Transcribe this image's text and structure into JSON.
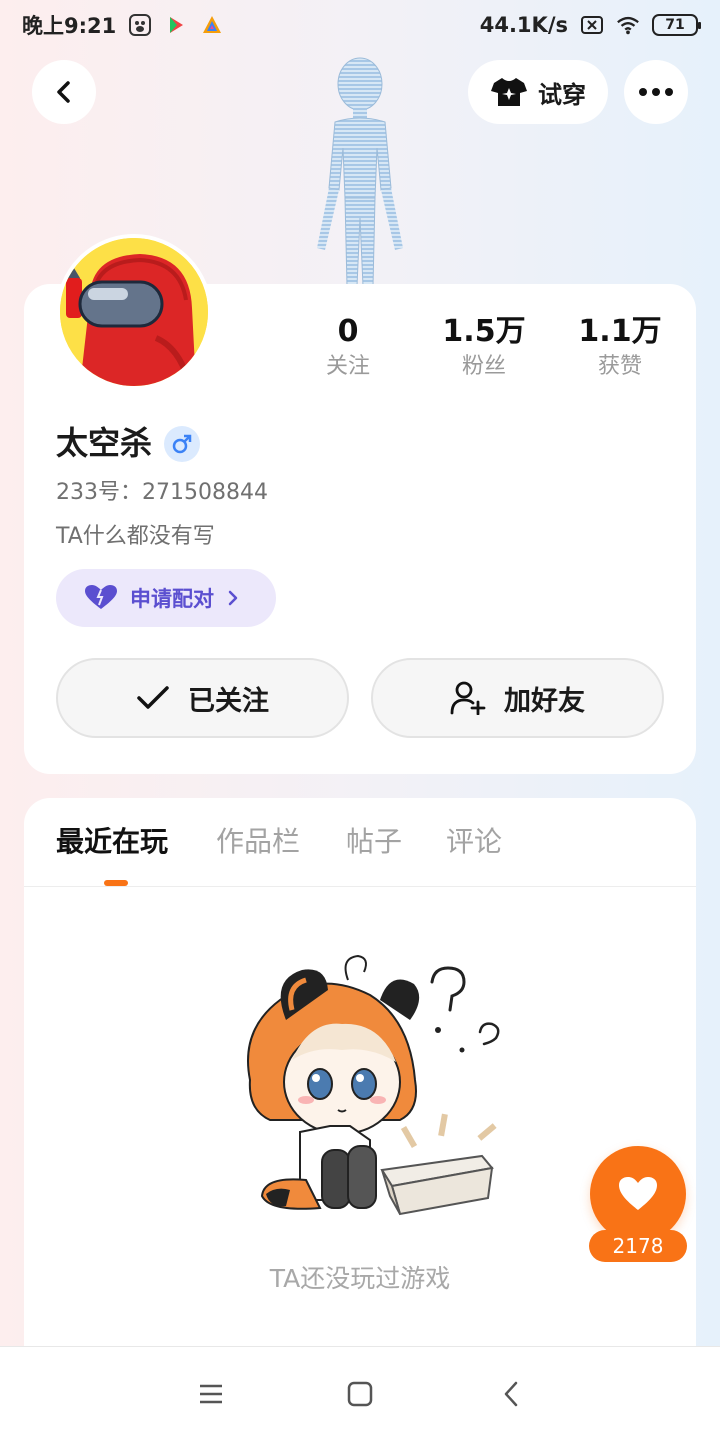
{
  "status_bar": {
    "time": "晚上9:21",
    "network_speed": "44.1K/s",
    "battery": "71"
  },
  "header": {
    "try_on_label": "试穿"
  },
  "profile": {
    "stats": [
      {
        "value": "0",
        "label": "关注"
      },
      {
        "value": "1.5万",
        "label": "粉丝"
      },
      {
        "value": "1.1万",
        "label": "获赞"
      }
    ],
    "name": "太空杀",
    "gender_symbol": "♂",
    "id_text": "233号：271508844",
    "bio": "TA什么都没有写",
    "pair_label": "申请配对",
    "followed_label": "已关注",
    "add_friend_label": "加好友"
  },
  "tabs": [
    {
      "label": "最近在玩",
      "active": true
    },
    {
      "label": "作品栏",
      "active": false
    },
    {
      "label": "帖子",
      "active": false
    },
    {
      "label": "评论",
      "active": false
    }
  ],
  "empty_state": {
    "text": "TA还没玩过游戏"
  },
  "like": {
    "count": "2178"
  },
  "colors": {
    "accent": "#f97316",
    "pair_text": "#5b4fd0",
    "pair_bg": "#ece8fb"
  }
}
